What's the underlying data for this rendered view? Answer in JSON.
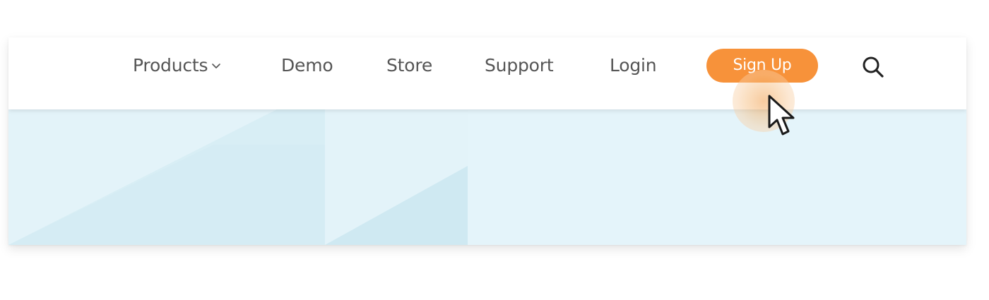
{
  "nav": {
    "products_label": "Products",
    "demo_label": "Demo",
    "store_label": "Store",
    "support_label": "Support",
    "login_label": "Login",
    "signup_label": "Sign Up"
  },
  "icons": {
    "products_dropdown": "chevron-down-icon",
    "search": "search-icon",
    "cursor": "mouse-pointer-icon"
  },
  "colors": {
    "accent": "#f7923a",
    "nav_text": "#555555",
    "hero_background": "#e3f3f9"
  }
}
